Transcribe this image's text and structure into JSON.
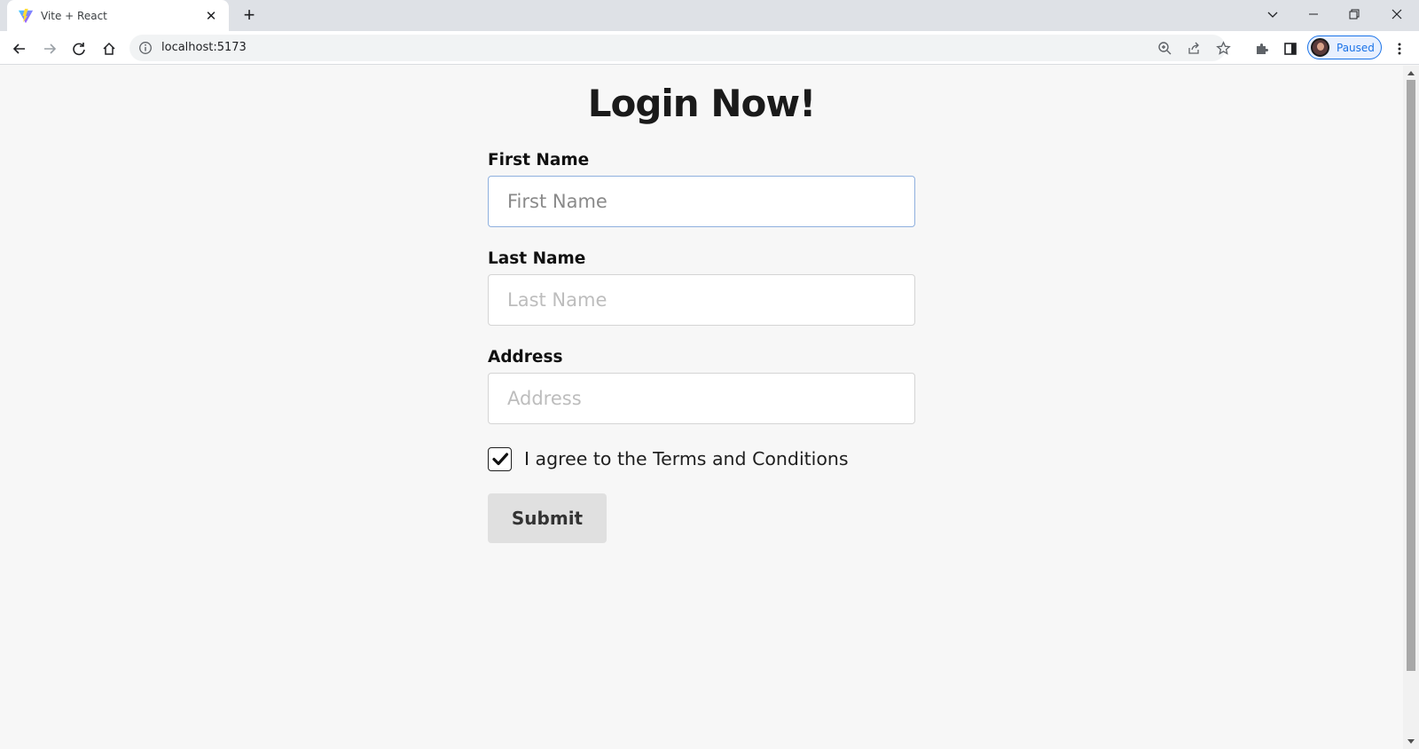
{
  "browser": {
    "tab_title": "Vite + React",
    "url": "localhost:5173",
    "profile_label": "Paused"
  },
  "page": {
    "title": "Login Now!",
    "first_name": {
      "label": "First Name",
      "placeholder": "First Name",
      "value": ""
    },
    "last_name": {
      "label": "Last Name",
      "placeholder": "Last Name",
      "value": ""
    },
    "address": {
      "label": "Address",
      "placeholder": "Address",
      "value": ""
    },
    "agree": {
      "label": "I agree to the Terms and Conditions",
      "checked": true
    },
    "submit_label": "Submit"
  },
  "colors": {
    "accent": "#1a73e8",
    "focus_border": "#8fb0de",
    "button_bg": "#e0e0e0"
  }
}
